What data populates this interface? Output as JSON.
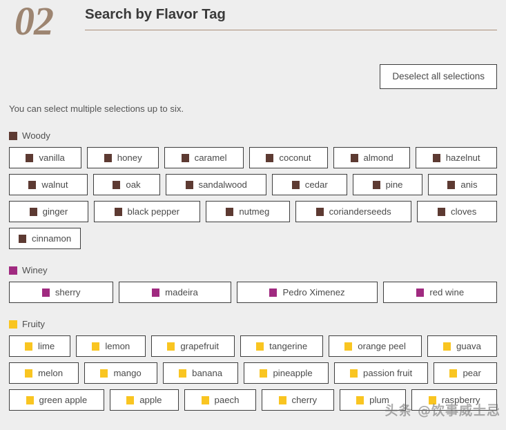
{
  "header": {
    "step_number": "02",
    "title": "Search by Flavor Tag"
  },
  "toolbar": {
    "deselect_label": "Deselect all selections"
  },
  "helper_text": "You can select multiple selections up to six.",
  "colors": {
    "page_background": "#eeeeee",
    "step_number": "#9d8571",
    "rule": "#a98e78",
    "tag_border": "#3c3c3c",
    "tag_background": "#ffffff",
    "woody": "#5d3a32",
    "winey": "#a02a80",
    "fruity": "#f9c521"
  },
  "categories": [
    {
      "name": "Woody",
      "label": "Woody",
      "swatch_color": "#5d3a32",
      "rows": [
        [
          "vanilla",
          "honey",
          "caramel",
          "coconut",
          "almond",
          "hazelnut"
        ],
        [
          "walnut",
          "oak",
          "sandalwood",
          "cedar",
          "pine",
          "anis"
        ],
        [
          "ginger",
          "black pepper",
          "nutmeg",
          "corianderseeds",
          "cloves"
        ],
        [
          "cinnamon"
        ]
      ]
    },
    {
      "name": "Winey",
      "label": "Winey",
      "swatch_color": "#a02a80",
      "rows": [
        [
          "sherry",
          "madeira",
          "Pedro Ximenez",
          "red wine"
        ]
      ]
    },
    {
      "name": "Fruity",
      "label": "Fruity",
      "swatch_color": "#f9c521",
      "rows": [
        [
          "lime",
          "lemon",
          "grapefruit",
          "tangerine",
          "orange peel",
          "guava"
        ],
        [
          "melon",
          "mango",
          "banana",
          "pineapple",
          "passion fruit",
          "pear"
        ],
        [
          "green apple",
          "apple",
          "paech",
          "cherry",
          "plum",
          "raspberry"
        ]
      ]
    }
  ],
  "watermark": {
    "text": "头条 @饮事威士忌"
  }
}
